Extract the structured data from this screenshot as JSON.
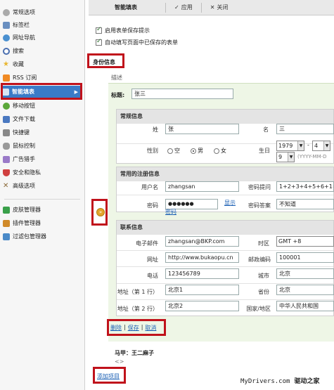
{
  "sidebar": {
    "items": [
      {
        "label": "常规选项",
        "icon": "gear-icon",
        "color": "#888888"
      },
      {
        "label": "标签栏",
        "icon": "tabs-icon",
        "color": "#6a8fc0"
      },
      {
        "label": "网址导航",
        "icon": "globe-icon",
        "color": "#4a90d0"
      },
      {
        "label": "搜索",
        "icon": "search-icon",
        "color": "#4a6fb0"
      },
      {
        "label": "收藏",
        "icon": "star-icon",
        "color": "#e8b630"
      },
      {
        "label": "RSS 订阅",
        "icon": "rss-icon",
        "color": "#f08a24"
      },
      {
        "label": "智能填表",
        "icon": "form-tools-icon",
        "color": "#ffffff"
      },
      {
        "label": "移动按钮",
        "icon": "move-button-icon",
        "color": "#5aa83a"
      },
      {
        "label": "文件下载",
        "icon": "download-icon",
        "color": "#4a78c0"
      },
      {
        "label": "快捷键",
        "icon": "keyboard-icon",
        "color": "#666666"
      },
      {
        "label": "鼠标控制",
        "icon": "mouse-icon",
        "color": "#777777"
      },
      {
        "label": "广告猎手",
        "icon": "ad-hunter-icon",
        "color": "#9a7ac8"
      },
      {
        "label": "安全和隐私",
        "icon": "shield-icon",
        "color": "#d04040"
      },
      {
        "label": "高级选项",
        "icon": "tools-icon",
        "color": "#8a6a3a"
      },
      {
        "label": "皮肤管理器",
        "icon": "skin-icon",
        "color": "#3aa04a"
      },
      {
        "label": "插件管理器",
        "icon": "plugin-icon",
        "color": "#d08a2a"
      },
      {
        "label": "过滤包管理器",
        "icon": "filter-icon",
        "color": "#4a8ac8"
      }
    ],
    "active_color": "#3a7bc8"
  },
  "toolbar": {
    "title": "智能填表",
    "apply_label": "应用",
    "close_label": "关闭"
  },
  "options": {
    "opt1": "启用表单保存提示",
    "opt2": "自动填写页面中已保存的表单"
  },
  "section_label": "身份信息",
  "profile": {
    "desc_label": "描述",
    "title_label": "标题:",
    "title_value": "张三"
  },
  "general": {
    "heading": "常规信息",
    "lastname_label": "姓",
    "lastname": "张",
    "firstname_label": "名",
    "firstname": "三",
    "gender_label": "性别",
    "gender_options": [
      "空",
      "男",
      "女"
    ],
    "birthday_label": "生日",
    "year": "1979",
    "month": "4",
    "day": "9",
    "date_hint": "(YYYY-MM-D"
  },
  "login": {
    "heading": "常用的注册信息",
    "username_label": "用户名",
    "username": "zhangsan",
    "question_label": "密码提问",
    "question": "1+2+3+4+5+6+1=?",
    "password_label": "密码",
    "password": "●●●●●●",
    "show_password_1": "显示",
    "show_password_2": "密码",
    "answer_label": "密码答案",
    "answer": "不知道"
  },
  "contact": {
    "heading": "联系信息",
    "email_label": "电子邮件",
    "email": "zhangsan@BKP.com",
    "timezone_label": "时区",
    "timezone": "GMT +8",
    "website_label": "网址",
    "website": "http://www.bukaopu.cn",
    "zip_label": "邮政编码",
    "zip": "100001",
    "phone_label": "电话",
    "phone": "123456789",
    "city_label": "城市",
    "city": "北京",
    "addr1_label": "地址（第 1 行）",
    "addr1": "北京1",
    "province_label": "省份",
    "province": "北京",
    "addr2_label": "地址（第 2 行）",
    "addr2": "北京2",
    "country_label": "国家/地区",
    "country": "中华人民共和国"
  },
  "actions": {
    "delete": "删除",
    "sep": "|",
    "save": "保存",
    "cancel": "取消"
  },
  "entry2": {
    "title": "马甲：王二麻子",
    "sub": "<>"
  },
  "add_item": "添加项目",
  "footer": {
    "site": "MyDrivers.com",
    "cn": "驱动之家"
  },
  "highlight_color": "#c0121b"
}
